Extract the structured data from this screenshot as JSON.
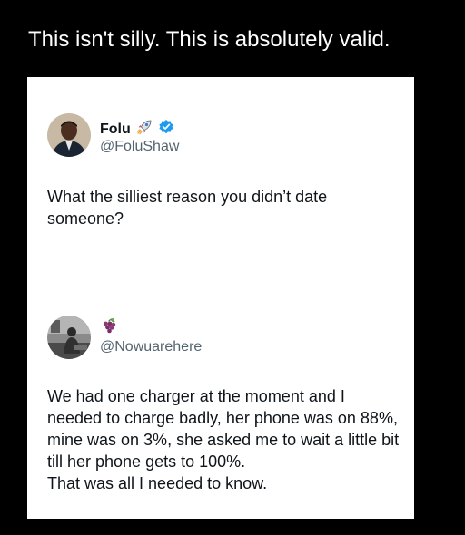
{
  "caption": "This isn't silly. This is absolutely valid.",
  "tweet": {
    "author_name": "Folu",
    "author_handle": "@FoluShaw",
    "verified": true,
    "name_emoji_icon": "rocket-icon",
    "text": "What the silliest reason you didn’t date\nsomeone?"
  },
  "reply": {
    "author_emoji_icon": "grapes-icon",
    "author_handle": "@Nowuarehere",
    "text": "We had one charger at the moment and I\nneeded to charge badly, her phone was on 88%,\nmine was on 3%, she asked me to wait a little bit\ntill her phone gets to 100%.\nThat was all I needed to know."
  },
  "colors": {
    "background": "#000000",
    "card": "#ffffff",
    "verified_badge": "#1d9bf0",
    "handle": "#536471",
    "text": "#0f1419"
  }
}
